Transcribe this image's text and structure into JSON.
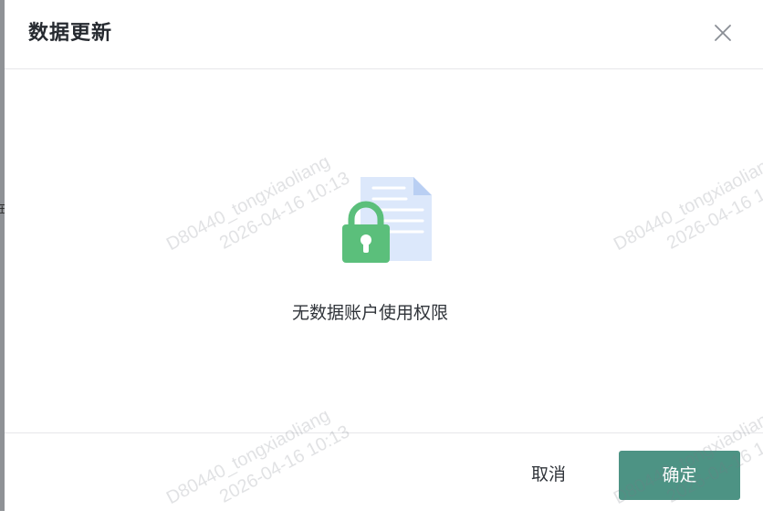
{
  "dialog": {
    "title": "数据更新",
    "close_icon": "close-icon",
    "empty_state": {
      "illustration": "locked-document-icon",
      "message": "无数据账户使用权限"
    },
    "buttons": {
      "cancel_label": "取消",
      "confirm_label": "确定"
    }
  },
  "watermark": {
    "user": "D80440_tongxiaoliang",
    "timestamp": "2026-04-16 10:13"
  },
  "background": {
    "partial_char": "在"
  },
  "colors": {
    "primary": "#4d9384",
    "lock_green": "#5bbf7b",
    "document_blue": "#dce8fb",
    "text": "#30343a",
    "divider": "#e6e7ea"
  }
}
